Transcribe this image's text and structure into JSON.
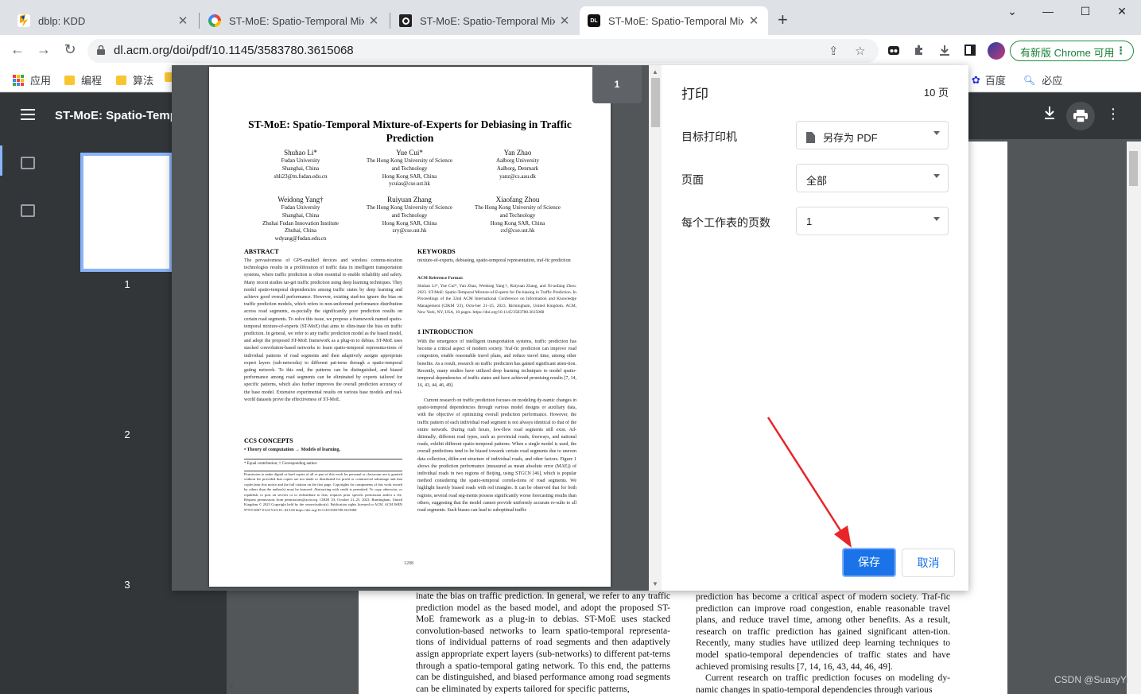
{
  "tabs": [
    {
      "title": "dblp: KDD"
    },
    {
      "title": "ST-MoE: Spatio-Temporal Mix"
    },
    {
      "title": "ST-MoE: Spatio-Temporal Mix"
    },
    {
      "title": "ST-MoE: Spatio-Temporal Mix"
    }
  ],
  "address_bar": {
    "url": "dl.acm.org/doi/pdf/10.1145/3583780.3615068"
  },
  "update_chip": {
    "label": "有新版 Chrome 可用"
  },
  "bookmarks": {
    "left": [
      {
        "label": "应用"
      },
      {
        "label": "编程"
      },
      {
        "label": "算法"
      }
    ],
    "right": [
      {
        "label": "百度"
      },
      {
        "label": "必应"
      }
    ]
  },
  "pdf_viewer": {
    "title": "ST-MoE: Spatio-Tempor",
    "thumbnails": [
      "1",
      "2",
      "3"
    ],
    "doc_left_text": "inate the bias on traffic prediction. In general, we refer to any traffic prediction model as the based model, and adopt the proposed ST-MoE framework as a plug-in to debias. ST-MoE uses stacked convolution-based networks to learn spatio-temporal representa-tions of individual patterns of road segments and then adaptively assign appropriate expert layers (sub-networks) to different pat-terns through a spatio-temporal gating network. To this end, the patterns can be distinguished, and biased performance among road segments can be eliminated by experts tailored for specific patterns,",
    "doc_right_text": "prediction has become a critical aspect of modern society. Traf-fic prediction can improve road congestion, enable reasonable travel plans, and reduce travel time, among other benefits. As a result, research on traffic prediction has gained significant atten-tion. Recently, many studies have utilized deep learning techniques to model spatio-temporal dependencies of traffic states and have achieved promising results [7, 14, 16, 43, 44, 46, 49].",
    "doc_right_text2": "Current research on traffic prediction focuses on modeling dy-namic changes in spatio-temporal dependencies through various",
    "watermark": "CSDN @SuasyYi"
  },
  "print_dialog": {
    "title": "打印",
    "page_count": "10 页",
    "page_badge": "1",
    "destination": {
      "label": "目标打印机",
      "value": "另存为 PDF"
    },
    "pages": {
      "label": "页面",
      "value": "全部"
    },
    "pages_per_sheet": {
      "label": "每个工作表的页数",
      "value": "1"
    },
    "save_label": "保存",
    "cancel_label": "取消"
  },
  "preview": {
    "title": "ST-MoE: Spatio-Temporal Mixture-of-Experts for Debiasing in Traffic Prediction",
    "authors": [
      {
        "name": "Shuhao Li*",
        "aff": "Fudan University\nShanghai, China\nshli23@m.fudan.edu.cn"
      },
      {
        "name": "Yue Cui*",
        "aff": "The Hong Kong University of Science\nand Technology\nHong Kong SAR, China\nycuias@cse.ust.hk"
      },
      {
        "name": "Yan Zhao",
        "aff": "Aalborg University\nAalborg, Denmark\nyanz@cs.aau.dk"
      },
      {
        "name": "Weidong Yang†",
        "aff": "Fudan University\nShanghai, China\nZhuhai Fudan Innovation Institute\nZhuhai, China\nwdyang@fudan.edu.cn"
      },
      {
        "name": "Ruiyuan Zhang",
        "aff": "The Hong Kong University of Science\nand Technology\nHong Kong SAR, China\nzry@cse.ust.hk"
      },
      {
        "name": "Xiaofang Zhou",
        "aff": "The Hong Kong University of Science\nand Technology\nHong Kong SAR, China\nzxf@cse.ust.hk"
      }
    ],
    "abstract_head": "ABSTRACT",
    "abstract": "The pervasiveness of GPS-enabled devices and wireless commu-nication technologies results in a proliferation of traffic data in intelligent transportation systems, where traffic prediction is often essential to enable reliability and safety. Many recent studies tar-get traffic prediction using deep learning techniques. They model spatio-temporal dependencies among traffic states by deep learning and achieve good overall performance. However, existing stud-ies ignore the bias on traffic prediction models, which refers to non-uniformed performance distribution across road segments, es-pecially the significantly poor prediction results on certain road segments. To solve this issue, we propose a framework named spatio-temporal mixture-of-experts (ST-MoE) that aims to elim-inate the bias on traffic prediction. In general, we refer to any traffic prediction model as the based model, and adopt the proposed ST-MoE framework as a plug-in to debias. ST-MoE uses stacked convolution-based networks to learn spatio-temporal representa-tions of individual patterns of road segments and then adaptively assigns appropriate expert layers (sub-networks) to different pat-terns through a spatio-temporal gating network. To this end, the patterns can be distinguished, and biased performance among road segments can be eliminated by experts tailored for specific patterns, which also further improves the overall prediction accuracy of the base model. Extensive experimental results on various base models and real-world datasets prove the effectiveness of ST-MoE.",
    "ccs_head": "CCS CONCEPTS",
    "ccs": "• Theory of computation → Models of learning.",
    "footnote": "* Equal contribution; † Corresponding author.",
    "permission": "Permission to make digital or hard copies of all or part of this work for personal or classroom use is granted without fee provided that copies are not made or distributed for profit or commercial advantage and that copies bear this notice and the full citation on the first page. Copyrights for components of this work owned by others than the author(s) must be honored. Abstracting with credit is permitted. To copy otherwise, or republish, to post on servers or to redistribute to lists, requires prior specific permission and/or a fee. Request permissions from permissions@acm.org. CIKM '23, October 21–25, 2023, Birmingham, United Kingdom © 2023 Copyright held by the owner/author(s). Publication rights licensed to ACM. ACM ISBN 979-8-4007-0124-5/23/10...$15.00 https://doi.org/10.1145/3583780.3615068",
    "keywords_head": "KEYWORDS",
    "keywords": "mixture-of-experts, debiasing, spatio-temporal representation, traf-fic prediction",
    "ref_head": "ACM Reference Format:",
    "ref": "Shuhao Li*, Yue Cui*, Yan Zhao, Weidong Yang†, Ruiyuan Zhang, and Xi-aofang Zhou. 2023. ST-MoE: Spatio-Temporal Mixture-of-Experts for De-biasing in Traffic Prediction. In Proceedings of the 32nd ACM International Conference on Information and Knowledge Management (CIKM '23), Octo-ber 21–25, 2023, Birmingham, United Kingdom. ACM, New York, NY, USA, 10 pages. https://doi.org/10.1145/3583780.3615068",
    "intro_head": "1   INTRODUCTION",
    "intro1": "With the emergence of intelligent transportation systems, traffic prediction has become a critical aspect of modern society. Traf-fic prediction can improve road congestion, enable reasonable travel plans, and reduce travel time, among other benefits. As a result, research on traffic prediction has gained significant atten-tion. Recently, many studies have utilized deep learning techniques to model spatio-temporal dependencies of traffic states and have achieved promising results [7, 14, 16, 43, 44, 46, 49].",
    "intro2": "Current research on traffic prediction focuses on modeling dy-namic changes in spatio-temporal dependencies through various model designs or auxiliary data, with the objective of optimizing overall prediction performance. However, the traffic pattern of each individual road segment is not always identical to that of the entire network. During rush hours, low-flow road segments still exist. Ad-ditionally, different road types, such as provincial roads, freeways, and national roads, exhibit different spatio-temporal patterns. When a single model is used, the overall predictions tend to be biased towards certain road segments due to uneven data collection, differ-ent structure of individual roads, and other factors. Figure 1 shows the prediction performance (measured as mean absolute error (MAE)) of individual roads in two regions of Beijing, using STGCN [46], which is popular method considering the spatio-temporal correla-tions of road segments. We highlight heavily biased roads with red triangles. It can be observed that for both regions, several road seg-ments possess significantly worse forecasting results than others, suggesting that the model cannot provide uniformly accurate re-sults to all road segments. Such biases can lead to suboptimal traffic",
    "page_number": "1208"
  },
  "colors": {
    "accent": "#1a73e8",
    "viewer_bg": "#525659",
    "viewer_bar": "#323639",
    "annotation_arrow": "#e8262a"
  }
}
